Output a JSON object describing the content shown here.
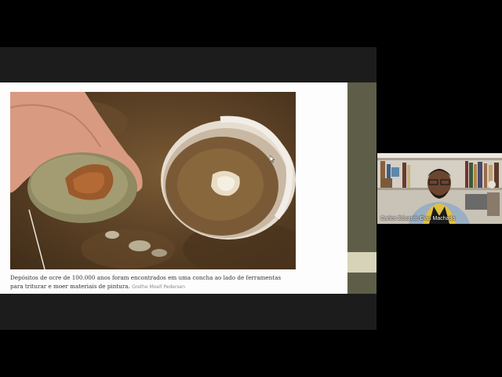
{
  "slide": {
    "caption": "Depósitos de ocre de 100.000 anos foram encontrados em uma concha ao lado de ferramentas para triturar e moer materiais de pintura.",
    "credit": "Grethe Moell Pedersen"
  },
  "participant": {
    "name": "Carlos Eduardo Dias Machado"
  },
  "colors": {
    "background": "#000000",
    "slide_page": "#fdfdfd",
    "side_strip": "#5e5e48",
    "ochre": "#a0602e"
  }
}
